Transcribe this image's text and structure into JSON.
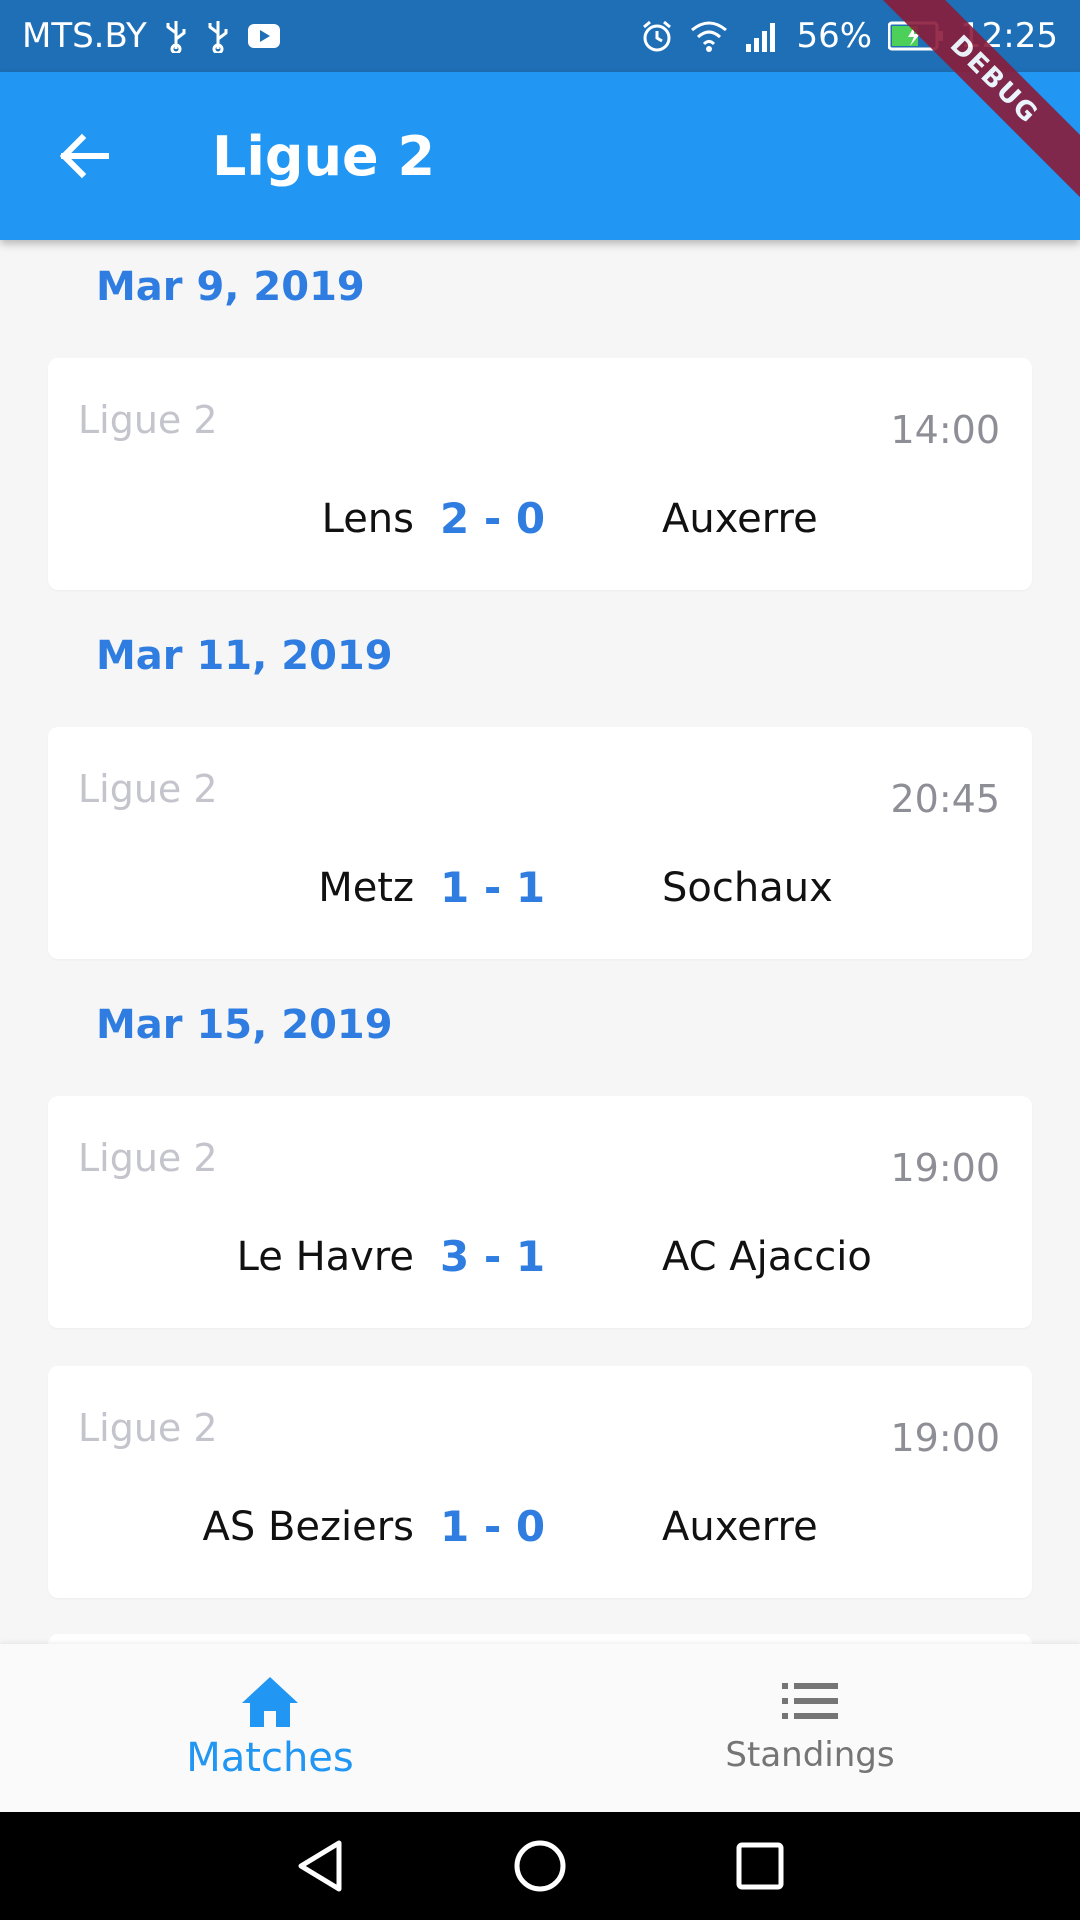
{
  "status_bar": {
    "carrier": "MTS.BY",
    "battery": "56%",
    "time": "12:25",
    "icons_left": [
      "usb-icon",
      "usb-icon",
      "youtube-icon"
    ],
    "icons_right": [
      "alarm-icon",
      "wifi-icon",
      "signal-icon",
      "battery-charging-icon"
    ]
  },
  "app_bar": {
    "title": "Ligue 2",
    "back_icon": "arrow-back-icon"
  },
  "debug_banner": "DEBUG",
  "matches": [
    {
      "date": "Mar 9, 2019",
      "league": "Ligue 2",
      "time": "14:00",
      "home": "Lens",
      "score": "2 - 0",
      "away": "Auxerre"
    },
    {
      "date": "Mar 11, 2019",
      "league": "Ligue 2",
      "time": "20:45",
      "home": "Metz",
      "score": "1 - 1",
      "away": "Sochaux"
    },
    {
      "date": "Mar 15, 2019",
      "league": "Ligue 2",
      "time": "19:00",
      "home": "Le Havre",
      "score": "3 - 1",
      "away": "AC Ajaccio"
    },
    {
      "league": "Ligue 2",
      "time": "19:00",
      "home": "AS Beziers",
      "score": "1 - 0",
      "away": "Auxerre"
    }
  ],
  "bottom_nav": {
    "matches_label": "Matches",
    "standings_label": "Standings",
    "active": "matches"
  },
  "colors": {
    "status_bar": "#1e6fb6",
    "app_bar": "#2196f3",
    "accent": "#2f7de1",
    "background": "#f6f6f6"
  }
}
